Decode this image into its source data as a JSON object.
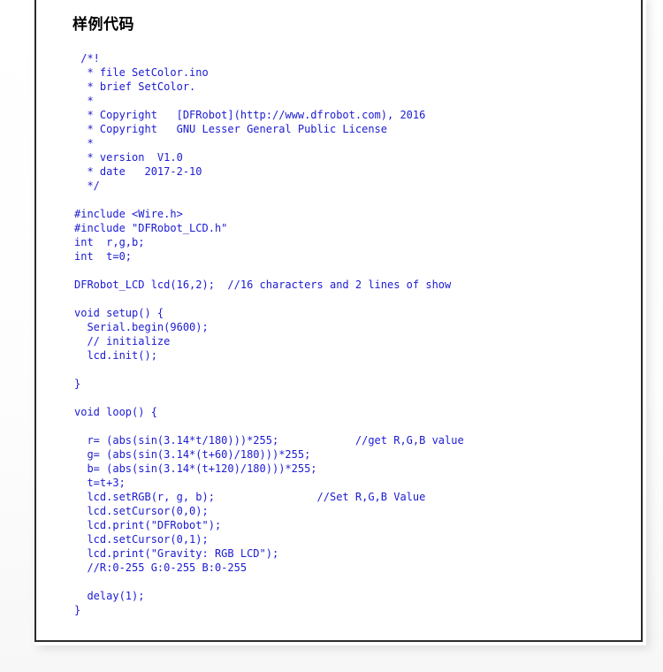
{
  "page": {
    "title": "样例代码",
    "code_color": "#1b1bd2",
    "title_color": "#000000",
    "background_color": "#ffffff",
    "border_color": "#2b2b2b"
  },
  "code": {
    "language": "arduino",
    "lines": [
      " /*!",
      "  * file SetColor.ino",
      "  * brief SetColor.",
      "  *",
      "  * Copyright   [DFRobot](http://www.dfrobot.com), 2016",
      "  * Copyright   GNU Lesser General Public License",
      "  *",
      "  * version  V1.0",
      "  * date   2017-2-10",
      "  */",
      "",
      "#include <Wire.h>",
      "#include \"DFRobot_LCD.h\"",
      "int  r,g,b;",
      "int  t=0;",
      "",
      "DFRobot_LCD lcd(16,2);  //16 characters and 2 lines of show",
      "",
      "void setup() {",
      "  Serial.begin(9600);",
      "  // initialize",
      "  lcd.init();",
      "",
      "}",
      "",
      "void loop() {",
      "",
      "  r= (abs(sin(3.14*t/180)))*255;            //get R,G,B value",
      "  g= (abs(sin(3.14*(t+60)/180)))*255;",
      "  b= (abs(sin(3.14*(t+120)/180)))*255;",
      "  t=t+3;",
      "  lcd.setRGB(r, g, b);                //Set R,G,B Value",
      "  lcd.setCursor(0,0);",
      "  lcd.print(\"DFRobot\");",
      "  lcd.setCursor(0,1);",
      "  lcd.print(\"Gravity: RGB LCD\");",
      "  //R:0-255 G:0-255 B:0-255",
      "",
      "  delay(1);",
      "}"
    ]
  }
}
